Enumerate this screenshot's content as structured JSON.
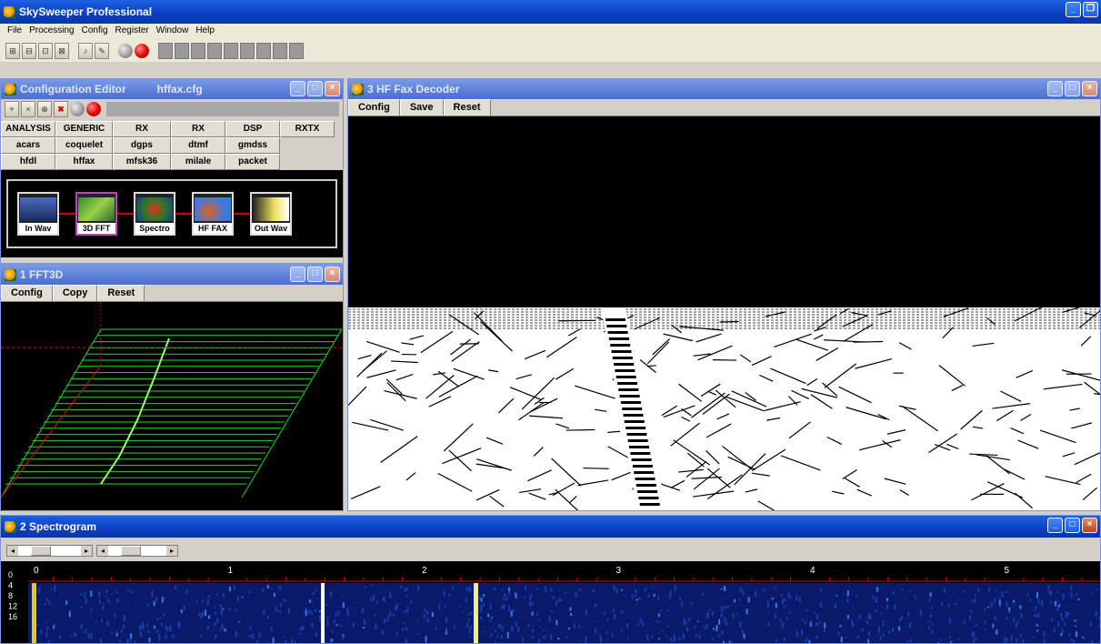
{
  "app": {
    "title": "SkySweeper Professional"
  },
  "menu": [
    "File",
    "Processing",
    "Config",
    "Register",
    "Window",
    "Help"
  ],
  "config_editor": {
    "title": "Configuration Editor",
    "file": "hffax.cfg",
    "tabs_row1": [
      "ANALYSIS",
      "GENERIC",
      "RX",
      "RX",
      "DSP",
      "RXTX"
    ],
    "tabs_row2": [
      "acars",
      "coquelet",
      "dgps",
      "dtmf",
      "gmdss"
    ],
    "tabs_row3": [
      "hfdl",
      "hffax",
      "mfsk36",
      "milale",
      "packet"
    ],
    "modules": [
      "In Wav",
      "3D FFT",
      "Spectro",
      "HF FAX",
      "Out Wav"
    ]
  },
  "fft": {
    "title": "1 FFT3D",
    "buttons": [
      "Config",
      "Copy",
      "Reset"
    ]
  },
  "fax": {
    "title": "3 HF Fax Decoder",
    "buttons": [
      "Config",
      "Save",
      "Reset"
    ]
  },
  "spectro": {
    "title": "2 Spectrogram",
    "x_ticks": [
      "0",
      "1",
      "2",
      "3",
      "4",
      "5"
    ],
    "y_ticks": [
      "0",
      "4",
      "8",
      "12",
      "16"
    ]
  },
  "colors": {
    "titlebar": "#0a3fc2",
    "green": "#1fd81f",
    "red": "#e00000"
  }
}
